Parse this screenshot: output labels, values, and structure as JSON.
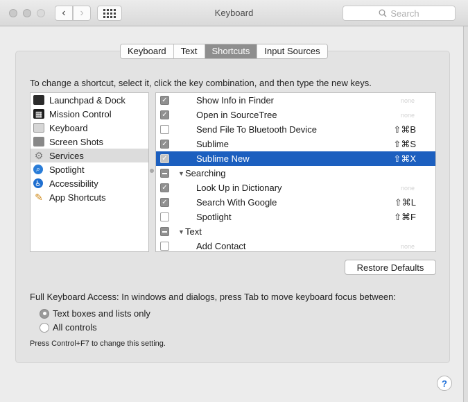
{
  "window": {
    "title": "Keyboard",
    "search_placeholder": "Search"
  },
  "toolbar": {
    "back_glyph": "‹",
    "forward_glyph": "›"
  },
  "tabs": [
    "Keyboard",
    "Text",
    "Shortcuts",
    "Input Sources"
  ],
  "active_tab": "Shortcuts",
  "instruction": "To change a shortcut, select it, click the key combination, and then type the new keys.",
  "categories": [
    {
      "label": "Launchpad & Dock",
      "icon": "launchpad-icon"
    },
    {
      "label": "Mission Control",
      "icon": "mission-control-icon"
    },
    {
      "label": "Keyboard",
      "icon": "keyboard-icon"
    },
    {
      "label": "Screen Shots",
      "icon": "screen-shots-icon"
    },
    {
      "label": "Services",
      "icon": "services-gear-icon",
      "selected": true
    },
    {
      "label": "Spotlight",
      "icon": "spotlight-search-icon"
    },
    {
      "label": "Accessibility",
      "icon": "accessibility-icon"
    },
    {
      "label": "App Shortcuts",
      "icon": "app-shortcuts-icon"
    }
  ],
  "shortcuts": [
    {
      "label": "Show Info in Finder",
      "checked": true,
      "keys": "none"
    },
    {
      "label": "Open in SourceTree",
      "checked": true,
      "keys": "none"
    },
    {
      "label": "Send File To Bluetooth Device",
      "checked": false,
      "keys": "⇧⌘B"
    },
    {
      "label": "Sublime",
      "checked": true,
      "keys": "⇧⌘S"
    },
    {
      "label": "Sublime New",
      "checked": true,
      "keys": "⇧⌘X",
      "selected": true
    },
    {
      "group": "Searching"
    },
    {
      "label": "Look Up in Dictionary",
      "checked": true,
      "keys": "none"
    },
    {
      "label": "Search With Google",
      "checked": true,
      "keys": "⇧⌘L"
    },
    {
      "label": "Spotlight",
      "checked": false,
      "keys": "⇧⌘F"
    },
    {
      "group": "Text"
    },
    {
      "label": "Add Contact",
      "checked": false,
      "keys": "none"
    }
  ],
  "restore_button": "Restore Defaults",
  "full_keyboard_access": {
    "text": "Full Keyboard Access: In windows and dialogs, press Tab to move keyboard focus between:",
    "options": [
      "Text boxes and lists only",
      "All controls"
    ],
    "selected": "Text boxes and lists only",
    "note": "Press Control+F7 to change this setting."
  },
  "help_label": "?"
}
